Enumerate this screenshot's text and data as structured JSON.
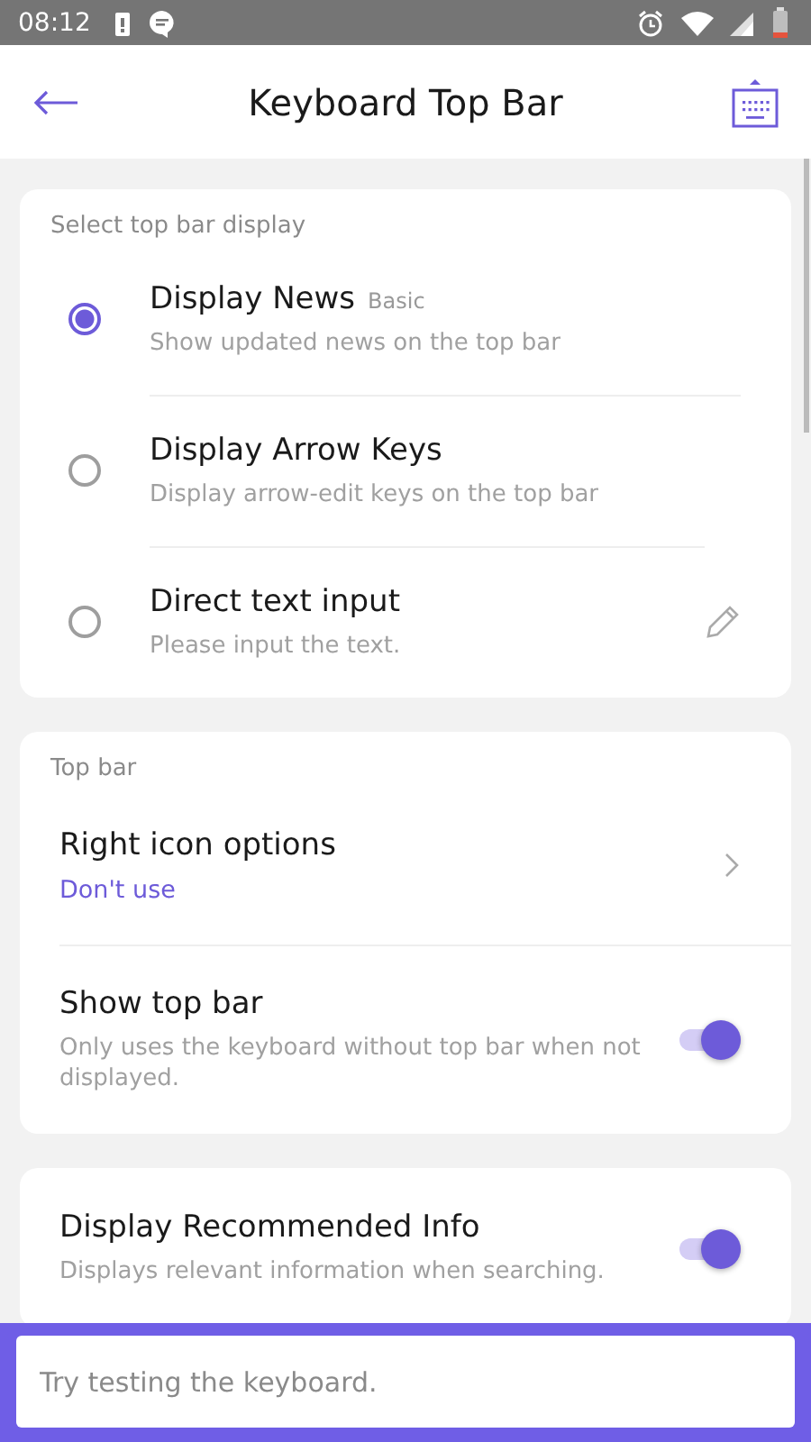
{
  "status_bar": {
    "time": "08:12"
  },
  "header": {
    "title": "Keyboard Top Bar"
  },
  "sections": [
    {
      "title": "Select top bar display",
      "items": [
        {
          "kind": "radio",
          "title": "Display News",
          "badge": "Basic",
          "subtitle": "Show updated news on the top bar",
          "selected": true
        },
        {
          "kind": "radio",
          "title": "Display Arrow Keys",
          "subtitle": "Display arrow-edit keys on the top bar",
          "selected": false
        },
        {
          "kind": "radio",
          "title": "Direct text input",
          "subtitle": "Please input the text.",
          "selected": false,
          "editable": true
        }
      ]
    },
    {
      "title": "Top bar",
      "items": [
        {
          "kind": "nav",
          "title": "Right icon options",
          "value": "Don't use"
        },
        {
          "kind": "toggle",
          "title": "Show top bar",
          "subtitle": "Only uses the keyboard without top bar when not displayed.",
          "on": true
        }
      ]
    },
    {
      "items": [
        {
          "kind": "toggle",
          "title": "Display Recommended Info",
          "subtitle": "Displays relevant information when searching.",
          "on": true
        }
      ]
    }
  ],
  "test_field": {
    "placeholder": "Try testing the keyboard."
  }
}
